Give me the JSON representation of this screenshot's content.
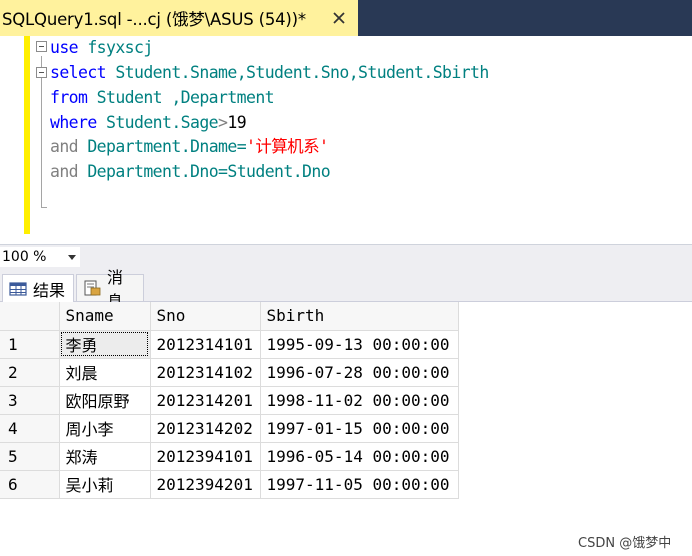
{
  "tab": {
    "title": "SQLQuery1.sql -...cj (饿梦\\ASUS (54))*"
  },
  "editor": {
    "lines": [
      {
        "keyword": "use",
        "rest": " fsyxscj"
      },
      {
        "keyword": "select",
        "rest": " Student.Sname,Student.Sno,Student.Sbirth"
      },
      {
        "keyword": "from",
        "rest": " Student ,Department"
      },
      {
        "keyword": "where",
        "rest": " Student.Sage",
        "op": ">",
        "num": "19"
      },
      {
        "keyword": "and",
        "rest": " Department.Dname=",
        "str": "'计算机系'"
      },
      {
        "keyword": "and",
        "rest": " Department.Dno=Student.Dno"
      }
    ]
  },
  "zoom": {
    "value": "100 %"
  },
  "result_tabs": {
    "results": "结果",
    "messages": "消息"
  },
  "grid": {
    "columns": [
      "Sname",
      "Sno",
      "Sbirth"
    ],
    "rows": [
      {
        "n": "1",
        "sname": "李勇",
        "sno": "2012314101",
        "sbirth": "1995-09-13 00:00:00"
      },
      {
        "n": "2",
        "sname": "刘晨",
        "sno": "2012314102",
        "sbirth": "1996-07-28 00:00:00"
      },
      {
        "n": "3",
        "sname": "欧阳原野",
        "sno": "2012314201",
        "sbirth": "1998-11-02 00:00:00"
      },
      {
        "n": "4",
        "sname": "周小李",
        "sno": "2012314202",
        "sbirth": "1997-01-15 00:00:00"
      },
      {
        "n": "5",
        "sname": "郑涛",
        "sno": "2012394101",
        "sbirth": "1996-05-14 00:00:00"
      },
      {
        "n": "6",
        "sname": "吴小莉",
        "sno": "2012394201",
        "sbirth": "1997-11-05 00:00:00"
      }
    ]
  },
  "watermark": "CSDN @饿梦中",
  "colors": {
    "tab_active": "#fff29d",
    "tabbar": "#293955",
    "keyword": "#0000ff",
    "identifier": "#008080",
    "string": "#ff0000",
    "margin": "#ffef00"
  }
}
